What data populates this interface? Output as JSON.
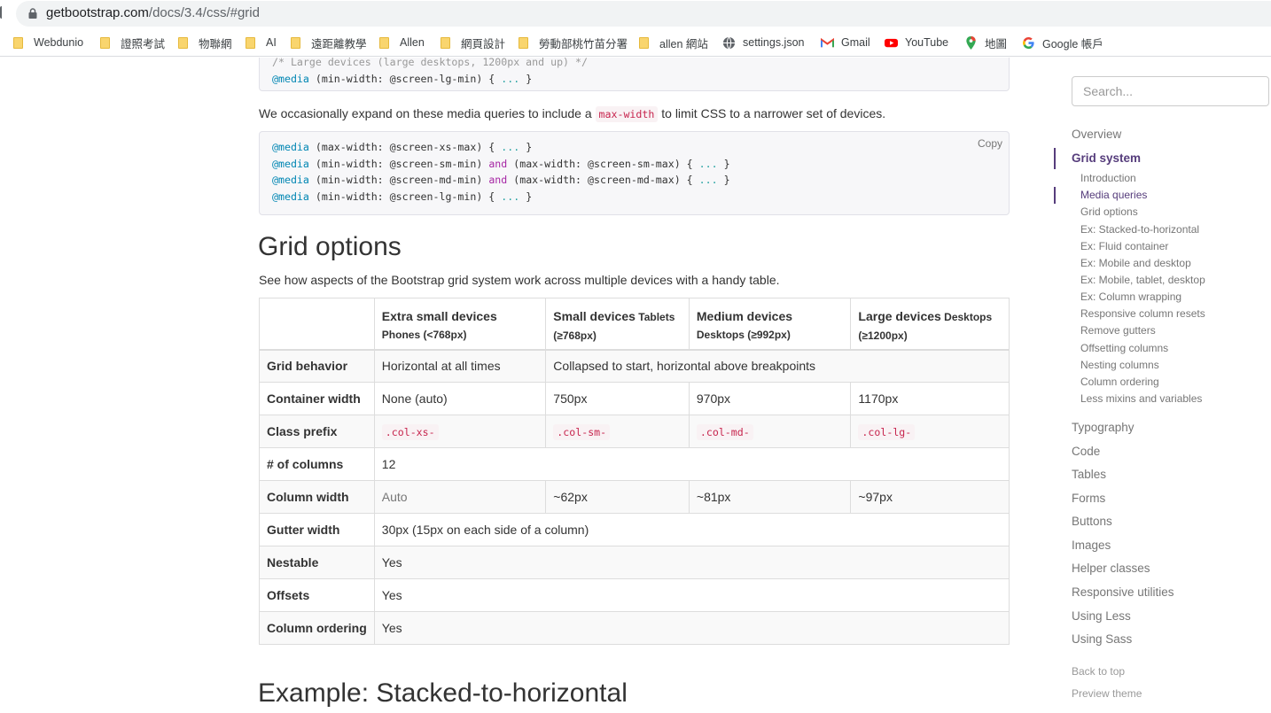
{
  "browser": {
    "url_host": "getbootstrap.com",
    "url_path": "/docs/3.4/css/#grid",
    "bookmarks": [
      {
        "label": "Webdunio",
        "icon": "folder-icon"
      },
      {
        "label": "證照考試",
        "icon": "folder-icon"
      },
      {
        "label": "物聯網",
        "icon": "folder-icon"
      },
      {
        "label": "AI",
        "icon": "folder-icon"
      },
      {
        "label": "遠距離教學",
        "icon": "folder-icon"
      },
      {
        "label": "Allen",
        "icon": "folder-icon"
      },
      {
        "label": "網頁設計",
        "icon": "folder-icon"
      },
      {
        "label": "勞動部桃竹苗分署",
        "icon": "folder-icon"
      },
      {
        "label": "allen 網站",
        "icon": "folder-icon"
      },
      {
        "label": "settings.json",
        "icon": "globe-icon"
      },
      {
        "label": "Gmail",
        "icon": "gmail-icon"
      },
      {
        "label": "YouTube",
        "icon": "youtube-icon"
      },
      {
        "label": "地圖",
        "icon": "maps-icon"
      },
      {
        "label": "Google 帳戶",
        "icon": "google-icon"
      }
    ]
  },
  "code1": {
    "comment_line": "/* Large devices (large desktops, 1200px and up) */",
    "lines": [
      "@media (min-width: @screen-lg-min) { ... }"
    ]
  },
  "para1": {
    "before": "We occasionally expand on these media queries to include a ",
    "code": "max-width",
    "after": " to limit CSS to a narrower set of devices."
  },
  "code2": {
    "copy_label": "Copy",
    "l1_kw": "@media",
    "l1_rest": " (max-width: @screen-xs-max) { ",
    "l2_kw": "@media",
    "l2_a": " (min-width: @screen-sm-min) ",
    "l2_and": "and",
    "l2_b": " (max-width: @screen-sm-max) { ",
    "l3_kw": "@media",
    "l3_a": " (min-width: @screen-md-min) ",
    "l3_and": "and",
    "l3_b": " (max-width: @screen-md-max) { ",
    "l4_kw": "@media",
    "l4_rest": " (min-width: @screen-lg-min) { ",
    "dots": "...",
    "close": " }"
  },
  "grid_options": {
    "heading": "Grid options",
    "intro": "See how aspects of the Bootstrap grid system work across multiple devices with a handy table."
  },
  "table": {
    "headers": [
      {
        "title": "Extra small devices",
        "sub": "Phones (<768px)"
      },
      {
        "title": "Small devices",
        "inline": " Tablets",
        "sub": "(≥768px)"
      },
      {
        "title": "Medium devices",
        "sub": "Desktops (≥992px)"
      },
      {
        "title": "Large devices",
        "inline": " Desktops",
        "sub": "(≥1200px)"
      }
    ],
    "rows": {
      "grid_behavior": {
        "label": "Grid behavior",
        "xs": "Horizontal at all times",
        "rest": "Collapsed to start, horizontal above breakpoints"
      },
      "container_width": {
        "label": "Container width",
        "xs": "None (auto)",
        "sm": "750px",
        "md": "970px",
        "lg": "1170px"
      },
      "class_prefix": {
        "label": "Class prefix",
        "xs": ".col-xs-",
        "sm": ".col-sm-",
        "md": ".col-md-",
        "lg": ".col-lg-"
      },
      "num_columns": {
        "label": "# of columns",
        "value": "12"
      },
      "column_width": {
        "label": "Column width",
        "xs": "Auto",
        "sm": "~62px",
        "md": "~81px",
        "lg": "~97px"
      },
      "gutter_width": {
        "label": "Gutter width",
        "value": "30px (15px on each side of a column)"
      },
      "nestable": {
        "label": "Nestable",
        "value": "Yes"
      },
      "offsets": {
        "label": "Offsets",
        "value": "Yes"
      },
      "column_ordering": {
        "label": "Column ordering",
        "value": "Yes"
      }
    }
  },
  "next_heading": "Example: Stacked-to-horizontal",
  "sidebar": {
    "search_placeholder": "Search...",
    "overview": "Overview",
    "grid_system": "Grid system",
    "sub": [
      "Introduction",
      "Media queries",
      "Grid options",
      "Ex: Stacked-to-horizontal",
      "Ex: Fluid container",
      "Ex: Mobile and desktop",
      "Ex: Mobile, tablet, desktop",
      "Ex: Column wrapping",
      "Responsive column resets",
      "Remove gutters",
      "Offsetting columns",
      "Nesting columns",
      "Column ordering",
      "Less mixins and variables"
    ],
    "sections": [
      "Typography",
      "Code",
      "Tables",
      "Forms",
      "Buttons",
      "Images",
      "Helper classes",
      "Responsive utilities",
      "Using Less",
      "Using Sass"
    ],
    "back_to_top": "Back to top",
    "preview_theme": "Preview theme"
  }
}
